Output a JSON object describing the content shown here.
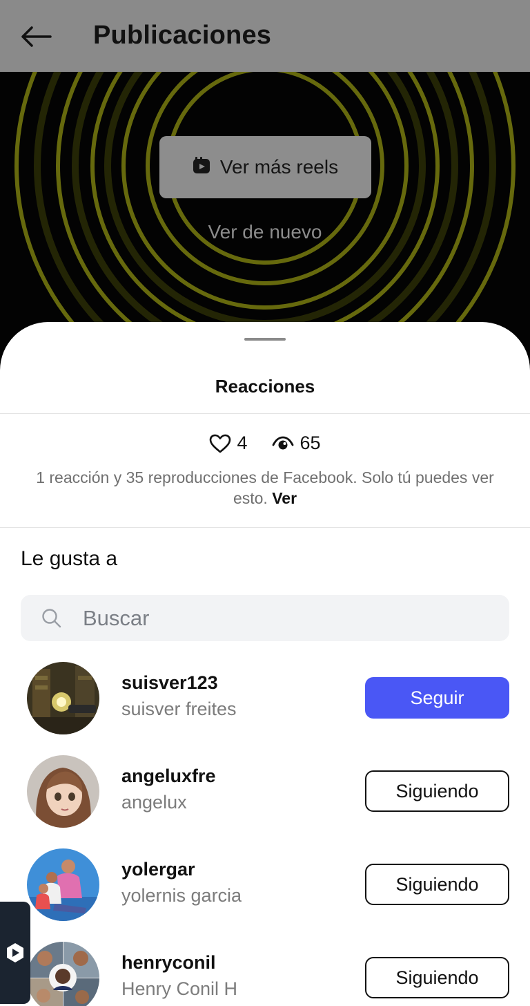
{
  "header": {
    "title": "Publicaciones",
    "back_icon": "arrow-left-icon"
  },
  "video": {
    "more_reels_label": "Ver más reels",
    "more_reels_icon": "reels-icon",
    "replay_label": "Ver de nuevo",
    "ring_color": "#b8bd18"
  },
  "sheet": {
    "title": "Reacciones",
    "likes_count": "4",
    "views_count": "65",
    "note_text": "1 reacción y 35 reproducciones de Facebook. Solo tú puedes ver esto.",
    "note_link": "Ver",
    "section_title": "Le gusta a",
    "search_placeholder": "Buscar"
  },
  "colors": {
    "accent": "#4a57f5",
    "header_bg": "#8a8a8a"
  },
  "users": [
    {
      "username": "suisver123",
      "fullname": "suisver freites",
      "action": "Seguir"
    },
    {
      "username": "angeluxfre",
      "fullname": "angelux",
      "action": "Siguiendo"
    },
    {
      "username": "yolergar",
      "fullname": "yolernis garcia",
      "action": "Siguiendo"
    },
    {
      "username": "henryconil",
      "fullname": "Henry Conil H",
      "action": "Siguiendo"
    }
  ]
}
